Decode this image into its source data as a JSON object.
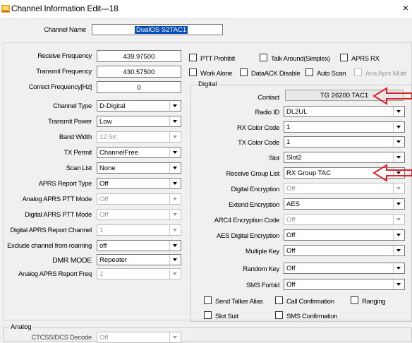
{
  "window": {
    "title": "Channel Information Edit---18",
    "close": "×"
  },
  "channel_name": {
    "label": "Channel Name",
    "value": "DualOS S2TAC1"
  },
  "freq": {
    "receive_label": "Receive Frequency",
    "receive_value": "439.97500",
    "transmit_label": "Transmit Frequency",
    "transmit_value": "430.57500",
    "correct_label": "Correct Frequency[Hz]",
    "correct_value": "0"
  },
  "checks_top": {
    "ptt_prohibit": "PTT Prohibit",
    "talk_around": "Talk Around(Simplex)",
    "aprs_rx": "APRS RX",
    "work_alone": "Work Alone",
    "dataack_disable": "DataACK Disable",
    "auto_scan": "Auto Scan",
    "ana_aprs_mute": "Ana Aprs Mute"
  },
  "left": {
    "channel_type": {
      "label": "Channel Type",
      "value": "D-Digital"
    },
    "transmit_power": {
      "label": "Transmit Power",
      "value": "Low"
    },
    "band_width": {
      "label": "Band Width",
      "value": "12.5K"
    },
    "tx_permit": {
      "label": "TX Permit",
      "value": "ChannelFree"
    },
    "scan_list": {
      "label": "Scan List",
      "value": "None"
    },
    "aprs_report_type": {
      "label": "APRS Report Type",
      "value": "Off"
    },
    "analog_aprs_ptt": {
      "label": "Analog APRS PTT Mode",
      "value": "Off"
    },
    "digital_aprs_ptt": {
      "label": "Digital APRS PTT Mode",
      "value": "Off"
    },
    "digital_aprs_channel": {
      "label": "Digital APRS Report Channel",
      "value": "1"
    },
    "exclude_roaming": {
      "label": "Exclude channel from roaming",
      "value": "off"
    },
    "dmr_mode": {
      "label": "DMR MODE",
      "value": "Repeater"
    },
    "analog_aprs_freq": {
      "label": "Analog APRS Report Freq",
      "value": "1"
    }
  },
  "digital": {
    "group_title": "Digital",
    "contact": {
      "label": "Contact",
      "value": "TG 26200 TAC1"
    },
    "radio_id": {
      "label": "Radio ID",
      "value": "DL2UL"
    },
    "rx_color": {
      "label": "RX Color Code",
      "value": "1"
    },
    "tx_color": {
      "label": "TX Color Code",
      "value": "1"
    },
    "slot": {
      "label": "Slot",
      "value": "Slot2"
    },
    "rx_group": {
      "label": "Receive Group List",
      "value": "RX Group TAC"
    },
    "digital_encryption": {
      "label": "Digital Encryption",
      "value": "Off"
    },
    "extend_encryption": {
      "label": "Extend Encryption",
      "value": "AES"
    },
    "arc4_code": {
      "label": "ARC4 Encryption Code",
      "value": "Off"
    },
    "aes_code": {
      "label": "AES Digital Encryption",
      "value": "Off"
    },
    "multiple_key": {
      "label": "Multiple Key",
      "value": "Off"
    },
    "random_key": {
      "label": "Random Key",
      "value": "Off"
    },
    "sms_forbid": {
      "label": "SMS Forbid",
      "value": "Off"
    },
    "checks": {
      "send_talker_alias": "Send Talker Alias",
      "call_confirmation": "Call Confirmation",
      "ranging": "Ranging",
      "slot_suit": "Slot Suit",
      "sms_confirmation": "SMS Confirmation"
    }
  },
  "analog": {
    "group_title": "Analog",
    "first_label": "CTCSS/DCS Decode",
    "first_value": "Off"
  },
  "colors": {
    "annotation_arrow": "#e0202a",
    "selection": "#0a4fb8"
  }
}
